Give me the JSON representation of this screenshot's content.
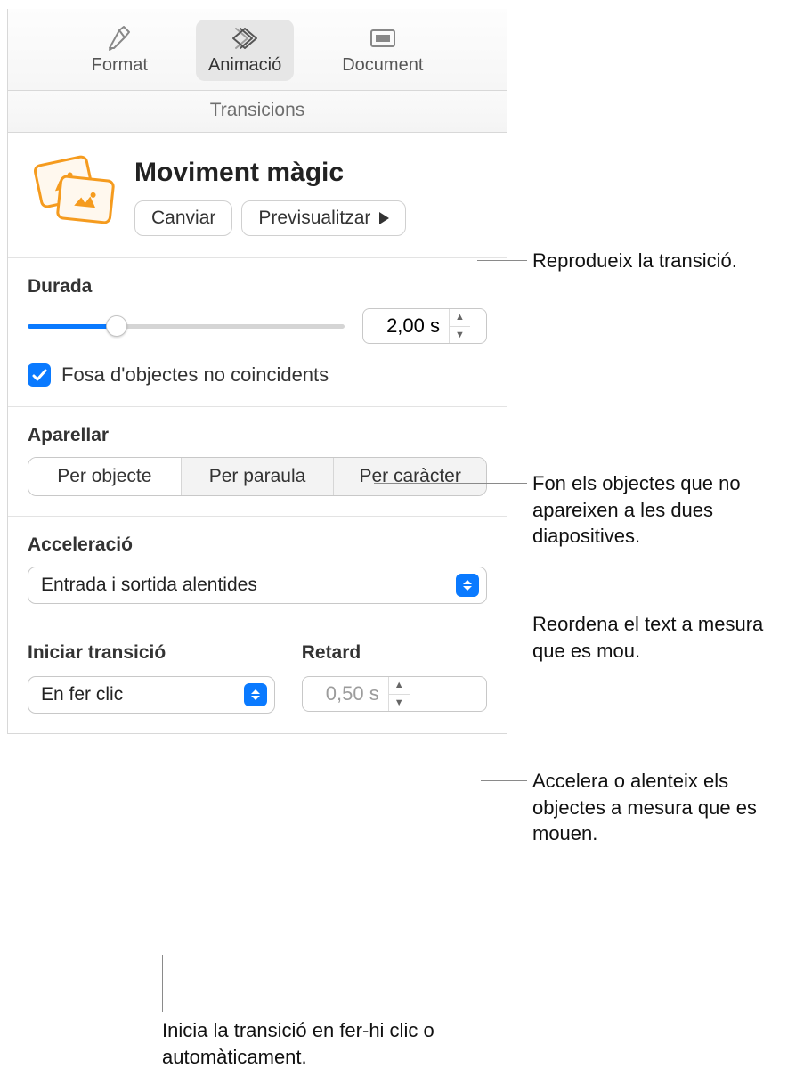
{
  "toolbar": {
    "format": "Format",
    "animation": "Animació",
    "document": "Document"
  },
  "tabstrip": {
    "transitions": "Transicions"
  },
  "header": {
    "title": "Moviment màgic",
    "change": "Canviar",
    "preview": "Previsualitzar"
  },
  "duration": {
    "label": "Durada",
    "value": "2,00 s",
    "fade_unmatched": "Fosa d'objectes no coincidents"
  },
  "match": {
    "label": "Aparellar",
    "options": [
      "Per objecte",
      "Per paraula",
      "Per caràcter"
    ]
  },
  "acceleration": {
    "label": "Acceleració",
    "value": "Entrada i sortida alentides"
  },
  "start": {
    "label": "Iniciar transició",
    "value": "En fer clic"
  },
  "delay": {
    "label": "Retard",
    "value": "0,50 s"
  },
  "callouts": {
    "preview": "Reprodueix la transició.",
    "fade": "Fon els objectes que no apareixen a les dues diapositives.",
    "match": "Reordena el text a mesura que es mou.",
    "accel": "Accelera o alenteix els objectes a mesura que es mouen.",
    "start": "Inicia la transició en fer-hi clic o automàticament."
  }
}
